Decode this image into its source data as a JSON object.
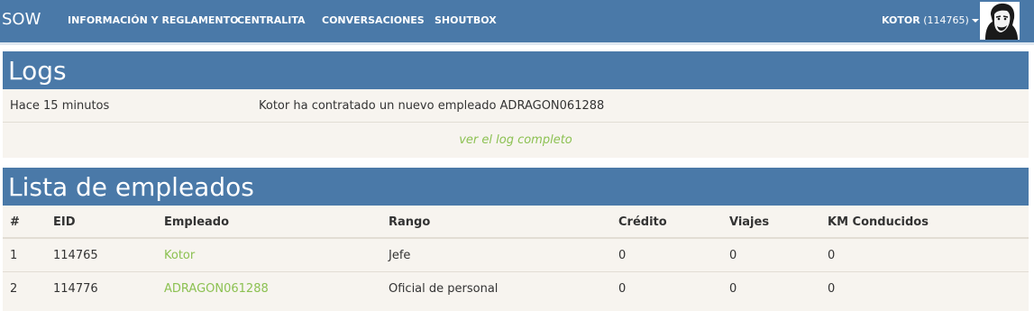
{
  "navbar": {
    "brand": "SOW",
    "links": [
      "INFORMACIÓN Y REGLAMENTO",
      "CENTRALITA",
      "CONVERSACIONES",
      "SHOUTBOX"
    ],
    "user": {
      "name": "KOTOR",
      "id": "(114765)"
    }
  },
  "logs": {
    "title": "Logs",
    "entries": [
      {
        "time": "Hace 15 minutos",
        "message": "Kotor ha contratado un nuevo empleado ADRAGON061288"
      }
    ],
    "more_link": "ver el log completo"
  },
  "employees": {
    "title": "Lista de empleados",
    "columns": [
      "#",
      "EID",
      "Empleado",
      "Rango",
      "Crédito",
      "Viajes",
      "KM Conducidos"
    ],
    "rows": [
      {
        "n": "1",
        "eid": "114765",
        "name": "Kotor",
        "rank": "Jefe",
        "credit": "0",
        "trips": "0",
        "km": "0"
      },
      {
        "n": "2",
        "eid": "114776",
        "name": "ADRAGON061288",
        "rank": "Oficial de personal",
        "credit": "0",
        "trips": "0",
        "km": "0"
      }
    ]
  },
  "colors": {
    "header": "#4a79a8",
    "panel": "#f7f4ef",
    "link": "#8cc152"
  }
}
